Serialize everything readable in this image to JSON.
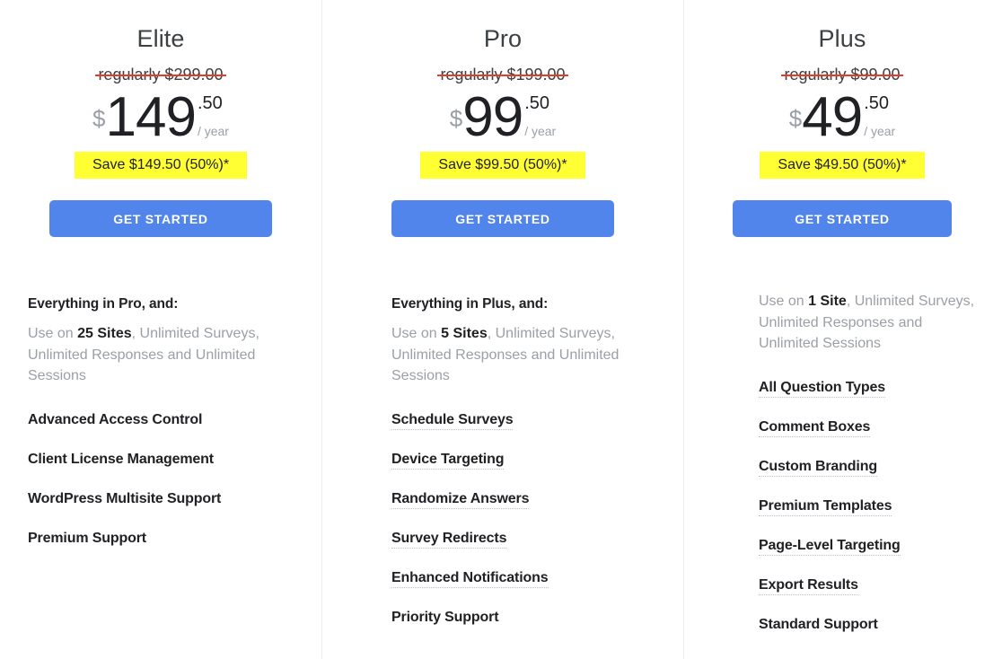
{
  "columns": [
    {
      "id": "elite",
      "title": "Elite",
      "regular_price": "regularly $299.00",
      "currency": "$",
      "amount": "149",
      "cents": ".50",
      "period": "/ year",
      "save_badge": "Save $149.50 (50%)*",
      "cta_label": "GET STARTED",
      "features_heading": "Everything in Pro, and:",
      "summary_prefix": "Use on ",
      "summary_bold": "25 Sites",
      "summary_suffix": ", Unlimited Surveys, Unlimited Responses and Unlimited Sessions",
      "features": [
        {
          "label": "Advanced Access Control",
          "tooltip": false
        },
        {
          "label": "Client License Management",
          "tooltip": false
        },
        {
          "label": "WordPress Multisite Support",
          "tooltip": false
        },
        {
          "label": "Premium Support",
          "tooltip": false
        }
      ]
    },
    {
      "id": "pro",
      "title": "Pro",
      "regular_price": "regularly $199.00",
      "currency": "$",
      "amount": "99",
      "cents": ".50",
      "period": "/ year",
      "save_badge": "Save $99.50 (50%)*",
      "cta_label": "GET STARTED",
      "features_heading": "Everything in Plus, and:",
      "summary_prefix": "Use on ",
      "summary_bold": "5 Sites",
      "summary_suffix": ", Unlimited Surveys, Unlimited Responses and Unlimited Sessions",
      "features": [
        {
          "label": "Schedule Surveys",
          "tooltip": true
        },
        {
          "label": "Device Targeting",
          "tooltip": true
        },
        {
          "label": "Randomize Answers",
          "tooltip": true
        },
        {
          "label": "Survey Redirects",
          "tooltip": true
        },
        {
          "label": "Enhanced Notifications",
          "tooltip": true
        },
        {
          "label": "Priority Support",
          "tooltip": false
        }
      ]
    },
    {
      "id": "plus",
      "title": "Plus",
      "regular_price": "regularly $99.00",
      "currency": "$",
      "amount": "49",
      "cents": ".50",
      "period": "/ year",
      "save_badge": "Save $49.50 (50%)*",
      "cta_label": "GET STARTED",
      "features_heading": "",
      "summary_prefix": "Use on ",
      "summary_bold": "1 Site",
      "summary_suffix": ", Unlimited Surveys, Unlimited Responses and Unlimited Sessions",
      "features": [
        {
          "label": "All Question Types",
          "tooltip": true
        },
        {
          "label": "Comment Boxes",
          "tooltip": true
        },
        {
          "label": "Custom Branding",
          "tooltip": true
        },
        {
          "label": "Premium Templates",
          "tooltip": true
        },
        {
          "label": "Page-Level Targeting",
          "tooltip": true
        },
        {
          "label": "Export Results",
          "tooltip": true
        },
        {
          "label": "Standard Support",
          "tooltip": false
        }
      ]
    }
  ],
  "colors": {
    "cta_blue": "#5285ec",
    "badge_yellow": "#ffff33",
    "strike_red": "#e8392a",
    "muted_text": "#9aa0a6",
    "dark_text": "#202124",
    "divider": "#eceef0"
  }
}
